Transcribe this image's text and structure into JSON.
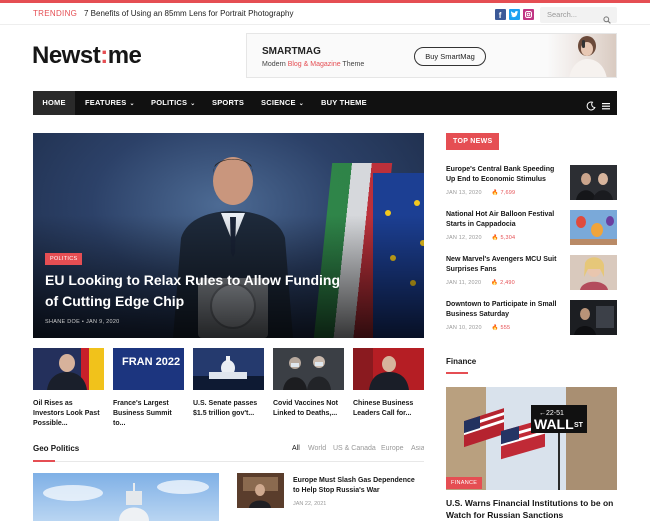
{
  "topbar": {
    "trending_label": "TRENDING",
    "trending_title": "7 Benefits of Using an 85mm Lens for Portrait Photography",
    "search_placeholder": "Search...",
    "social_icons": [
      "facebook-icon",
      "twitter-icon",
      "instagram-icon"
    ],
    "social_colors": [
      "#3b5998",
      "#1da1f2",
      "#c13584"
    ]
  },
  "header": {
    "logo_part1": "Newst",
    "logo_accent": ":",
    "logo_part2": "me",
    "ad_title": "SMARTMAG",
    "ad_sub_prefix": "Modern ",
    "ad_sub_highlight": "Blog & Magazine",
    "ad_sub_suffix": " Theme",
    "ad_button": "Buy SmartMag"
  },
  "nav": {
    "items": [
      {
        "label": "HOME"
      },
      {
        "label": "FEATURES"
      },
      {
        "label": "POLITICS"
      },
      {
        "label": "SPORTS"
      },
      {
        "label": "SCIENCE"
      },
      {
        "label": "BUY THEME"
      }
    ]
  },
  "hero": {
    "category": "POLITICS",
    "title": "EU Looking to Relax Rules to Allow Funding of Cutting Edge Chip",
    "meta": "SHANE DOE  •  JAN 9, 2020"
  },
  "thumbs": [
    {
      "title": "Oil Rises as Investors Look Past Possible..."
    },
    {
      "title": "France's Largest Business Summit to...",
      "image_text": "FRAN 2022"
    },
    {
      "title": "U.S. Senate passes $1.5 trillion gov't..."
    },
    {
      "title": "Covid Vaccines Not Linked to Deaths,..."
    },
    {
      "title": "Chinese Business Leaders Call for..."
    }
  ],
  "geo": {
    "title": "Geo Politics",
    "tabs": [
      "All",
      "World",
      "US & Canada",
      "Europe",
      "Asia"
    ],
    "side_title": "Europe Must Slash Gas Dependence to Help Stop Russia's War",
    "side_date": "JAN 22, 2021"
  },
  "sidebar": {
    "top_news_label": "TOP NEWS",
    "items": [
      {
        "title": "Europe's Central Bank Speeding Up End to Economic Stimulus",
        "date": "JAN 13, 2020",
        "views": "7,699"
      },
      {
        "title": "National Hot Air Balloon Festival Starts in Cappadocia",
        "date": "JAN 12, 2020",
        "views": "5,304"
      },
      {
        "title": "New Marvel's Avengers MCU Suit Surprises Fans",
        "date": "JAN 11, 2020",
        "views": "2,490"
      },
      {
        "title": "Downtown to Participate in Small Business Saturday",
        "date": "JAN 10, 2020",
        "views": "555"
      }
    ],
    "finance_title": "Finance",
    "finance_category": "FINANCE",
    "finance_sign_top": "←22-51",
    "finance_sign_main": "WALL",
    "finance_sign_st": "ST",
    "finance_headline": "U.S. Warns Financial Institutions to be on Watch for Russian Sanctions"
  }
}
